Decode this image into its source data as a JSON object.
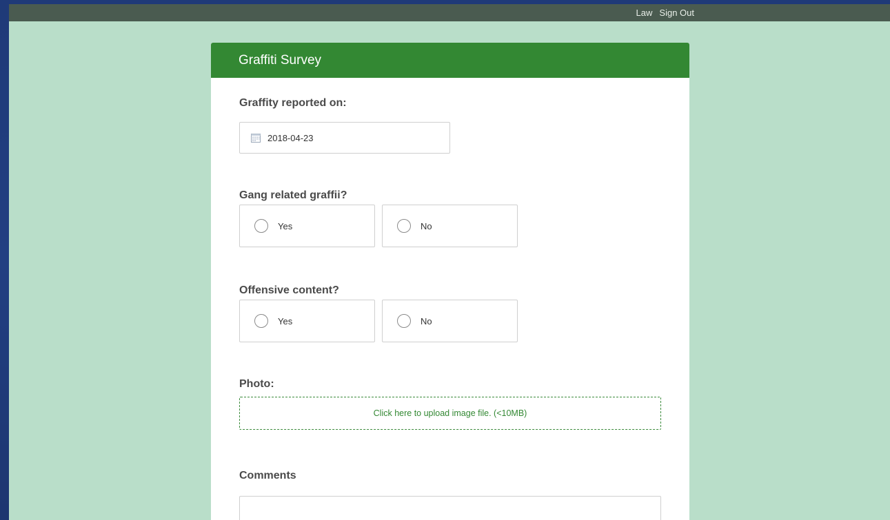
{
  "topbar": {
    "user_label": "Law",
    "signout_label": "Sign Out"
  },
  "survey": {
    "title": "Graffiti Survey",
    "date_question": {
      "label": "Graffity reported on:",
      "value": "2018-04-23",
      "icon": "calendar-icon"
    },
    "gang_question": {
      "label": "Gang related graffii?",
      "options": [
        "Yes",
        "No"
      ],
      "selected": null
    },
    "offensive_question": {
      "label": "Offensive content?",
      "options": [
        "Yes",
        "No"
      ],
      "selected": null
    },
    "photo": {
      "label": "Photo:",
      "upload_text": "Click here to upload image file. (<10MB)"
    },
    "comments": {
      "label": "Comments",
      "value": ""
    }
  },
  "colors": {
    "header_green": "#338833",
    "background_mint": "#b9dec9",
    "topbar": "#4a5b50",
    "outer_blue": "#223f82"
  }
}
